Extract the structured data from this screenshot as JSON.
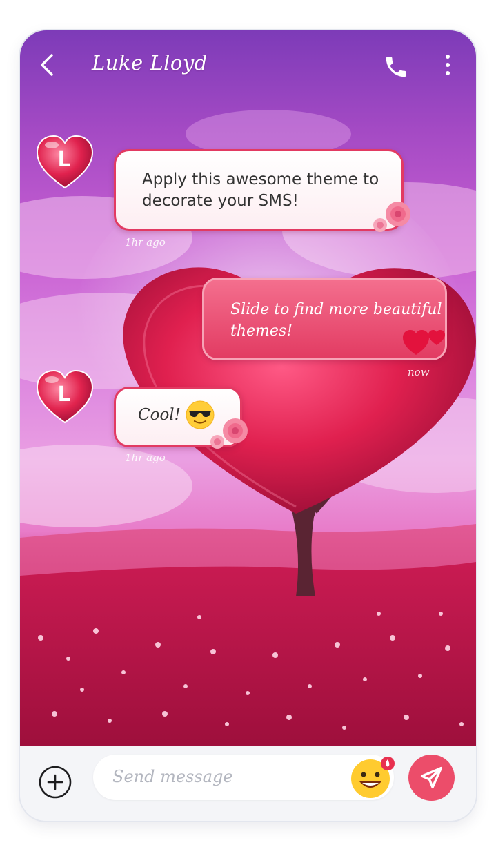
{
  "header": {
    "contact_name": "Luke Lloyd",
    "back_icon": "chevron-left-icon",
    "call_icon": "phone-icon",
    "more_icon": "more-vertical-icon"
  },
  "messages": [
    {
      "direction": "incoming",
      "avatar_letter": "L",
      "lines": [
        "Apply this awesome theme to",
        "decorate your SMS!"
      ],
      "time": "1hr ago"
    },
    {
      "direction": "outgoing",
      "lines": [
        "Slide to find more beautiful",
        "themes!"
      ],
      "time": "now"
    },
    {
      "direction": "incoming",
      "avatar_letter": "L",
      "text": "Cool!",
      "emoji": "sunglasses-emoji-icon",
      "time": "1hr ago"
    }
  ],
  "composer": {
    "placeholder": "Send message",
    "add_icon": "plus-circle-icon",
    "emoji_icon": "smiley-emoji-icon",
    "send_icon": "send-icon"
  },
  "colors": {
    "accent": "#ec4d6a",
    "bubble_border": "#e23a62",
    "sky_top": "#7d3bb8",
    "field_red": "#c01f5c"
  }
}
